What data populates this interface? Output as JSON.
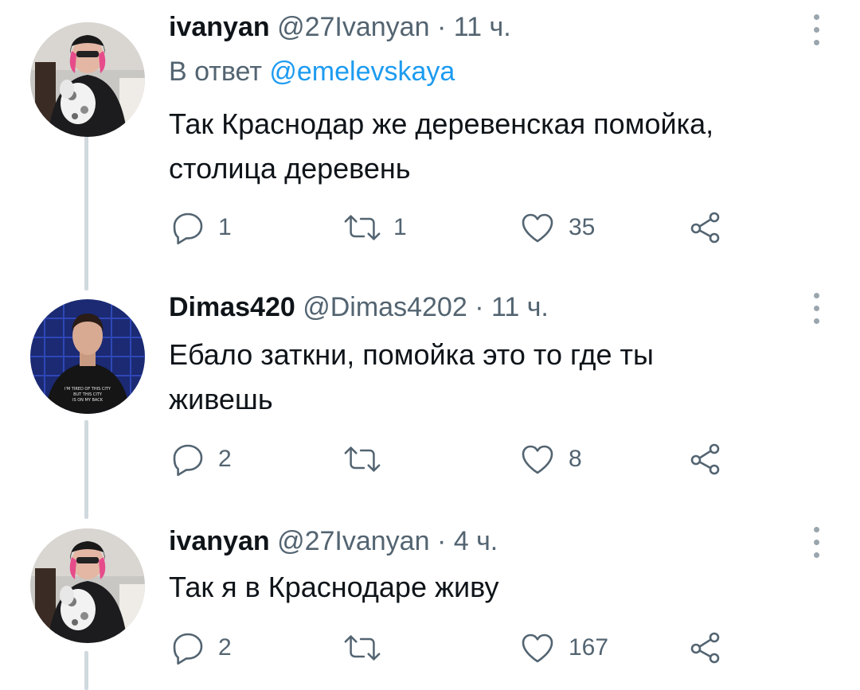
{
  "tweets": [
    {
      "name": "ivanyan",
      "handle": "@27Ivanyan",
      "separator": "·",
      "time": "11 ч.",
      "reply_prefix": "В ответ",
      "reply_mention": "@emelevskaya",
      "lines": [
        "Так Краснодар же деревенская помойка,",
        "столица деревень"
      ],
      "replies": "1",
      "retweets": "1",
      "likes": "35"
    },
    {
      "name": "Dimas420",
      "handle": "@Dimas4202",
      "separator": "·",
      "time": "11 ч.",
      "avatar_shirt_text": [
        "I'M TIRED OF THIS CITY",
        "BUT THIS CITY",
        "IS ON MY BACK"
      ],
      "lines": [
        "Ебало заткни, помойка это то где ты",
        "живешь"
      ],
      "replies": "2",
      "retweets": "",
      "likes": "8"
    },
    {
      "name": "ivanyan",
      "handle": "@27Ivanyan",
      "separator": "·",
      "time": "4 ч.",
      "lines": [
        "Так я в Краснодаре живу"
      ],
      "replies": "2",
      "retweets": "",
      "likes": "167"
    }
  ],
  "icons": {
    "reply": "reply-icon",
    "retweet": "retweet-icon",
    "like": "heart-icon",
    "share": "share-icon",
    "menu": "more-vertical-icon"
  },
  "colors": {
    "text": "#0f1419",
    "muted": "#536471",
    "link": "#1d9bf0",
    "thread_line": "#cfd9de"
  }
}
